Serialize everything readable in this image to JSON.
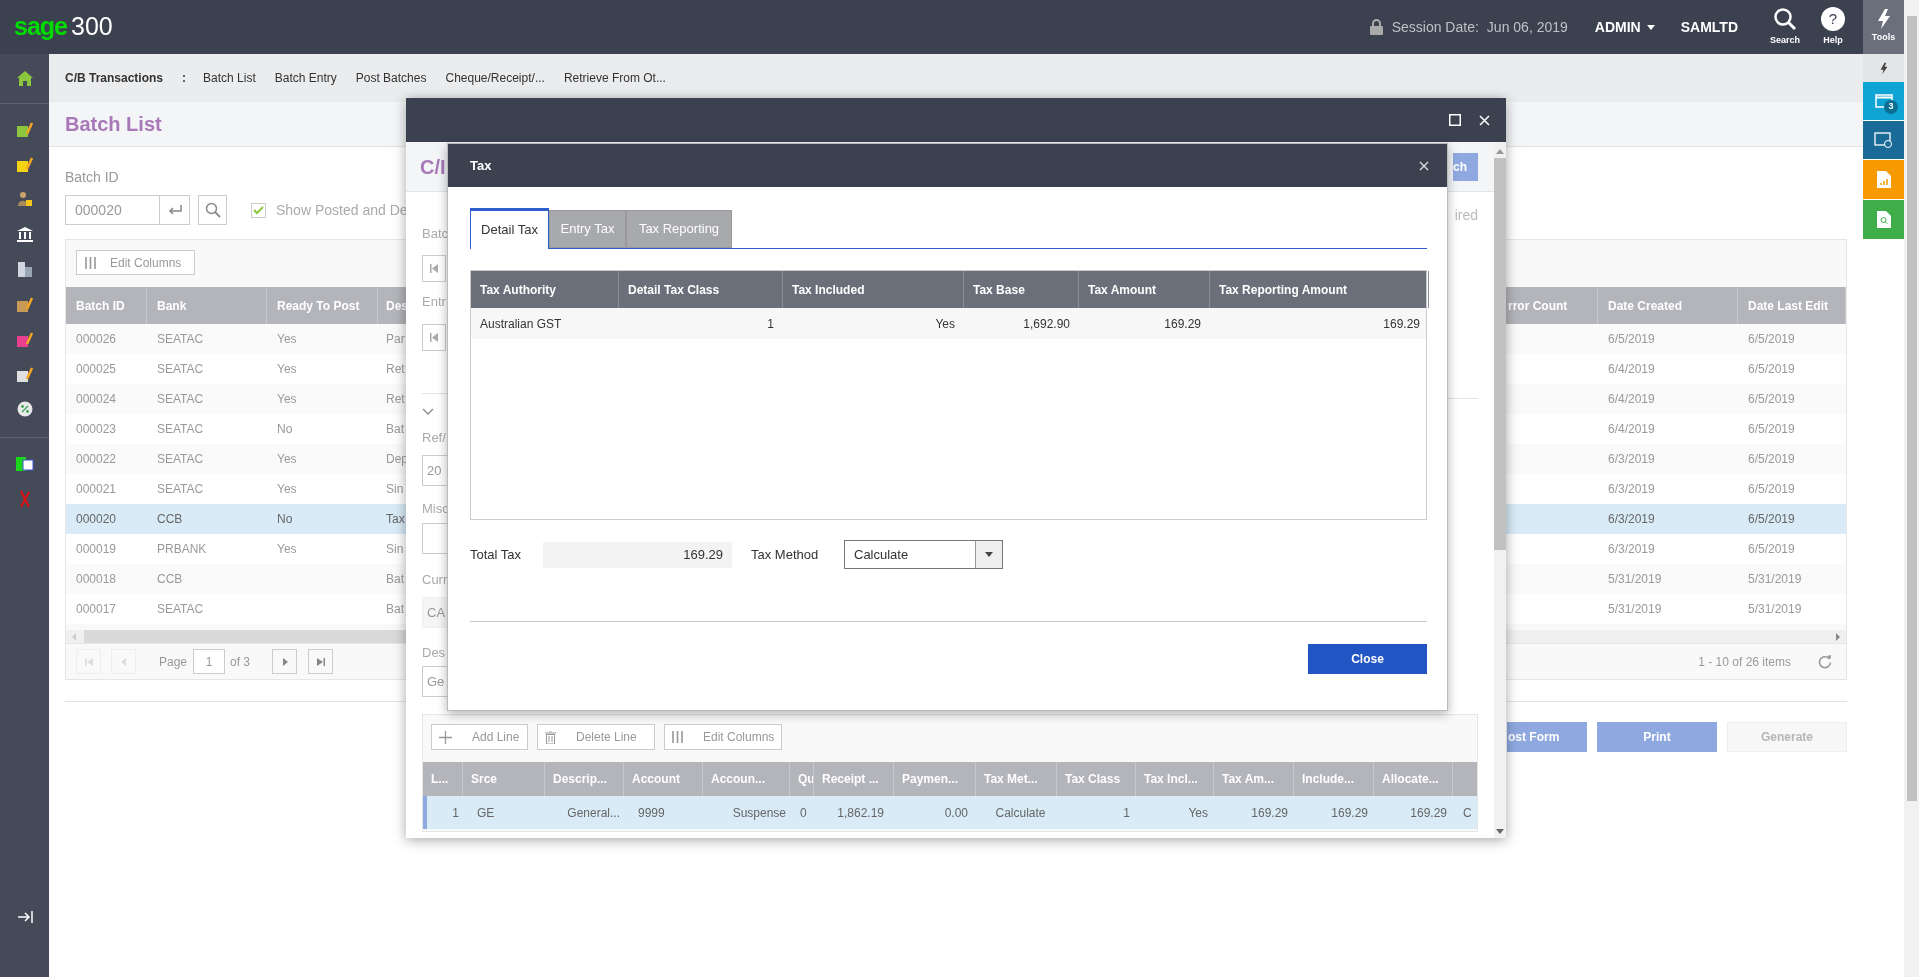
{
  "top_bar": {
    "logo_brand": "sage",
    "logo_product": "300",
    "session_label": "Session Date:",
    "session_date": "Jun 06, 2019",
    "user": "ADMIN",
    "company": "SAMLTD",
    "search_label": "Search",
    "help_label": "Help",
    "help_glyph": "?"
  },
  "tool_rail": {
    "tools_label": "Tools",
    "window_count": "3"
  },
  "breadcrumb": {
    "title": "C/B Transactions",
    "separator": ":",
    "links": [
      "Batch List",
      "Batch Entry",
      "Post Batches",
      "Cheque/Receipt/...",
      "Retrieve From Ot..."
    ]
  },
  "page_title": "Batch List",
  "filter": {
    "label": "Batch ID",
    "value": "000020",
    "show_posted_label": "Show Posted and De",
    "show_posted_checked": true
  },
  "edit_columns": "Edit Columns",
  "batch_table": {
    "columns_left": [
      "Batch ID",
      "Bank",
      "Ready To Post",
      "Des"
    ],
    "columns_right": [
      "rror Count",
      "Date Created",
      "Date Last Edit"
    ],
    "rows": [
      {
        "batch_id": "000026",
        "bank": "SEATAC",
        "ready": "Yes",
        "description": "Par",
        "date_created": "6/5/2019",
        "date_last_edit": "6/5/2019",
        "selected": false
      },
      {
        "batch_id": "000025",
        "bank": "SEATAC",
        "ready": "Yes",
        "description": "Ret",
        "date_created": "6/4/2019",
        "date_last_edit": "6/5/2019",
        "selected": false
      },
      {
        "batch_id": "000024",
        "bank": "SEATAC",
        "ready": "Yes",
        "description": "Ret",
        "date_created": "6/4/2019",
        "date_last_edit": "6/5/2019",
        "selected": false
      },
      {
        "batch_id": "000023",
        "bank": "SEATAC",
        "ready": "No",
        "description": "Bat",
        "date_created": "6/4/2019",
        "date_last_edit": "6/5/2019",
        "selected": false
      },
      {
        "batch_id": "000022",
        "bank": "SEATAC",
        "ready": "Yes",
        "description": "Dep",
        "date_created": "6/3/2019",
        "date_last_edit": "6/5/2019",
        "selected": false
      },
      {
        "batch_id": "000021",
        "bank": "SEATAC",
        "ready": "Yes",
        "description": "Sin",
        "date_created": "6/3/2019",
        "date_last_edit": "6/5/2019",
        "selected": false
      },
      {
        "batch_id": "000020",
        "bank": "CCB",
        "ready": "No",
        "description": "Tax",
        "date_created": "6/3/2019",
        "date_last_edit": "6/5/2019",
        "selected": true
      },
      {
        "batch_id": "000019",
        "bank": "PRBANK",
        "ready": "Yes",
        "description": "Sin",
        "date_created": "6/3/2019",
        "date_last_edit": "6/5/2019",
        "selected": false
      },
      {
        "batch_id": "000018",
        "bank": "CCB",
        "description": "Bat",
        "date_created": "5/31/2019",
        "date_last_edit": "5/31/2019",
        "selected": false
      },
      {
        "batch_id": "000017",
        "bank": "SEATAC",
        "description": "Bat",
        "date_created": "5/31/2019",
        "date_last_edit": "5/31/2019",
        "selected": false
      }
    ]
  },
  "pager": {
    "label": "Page",
    "page": "1",
    "of": "of 3",
    "summary": "1 - 10 of 26 items"
  },
  "actions": [
    {
      "label": "ost Form",
      "disabled": false
    },
    {
      "label": "Print",
      "disabled": false
    },
    {
      "label": "Generate",
      "disabled": true
    }
  ],
  "entry_window": {
    "title": "C/I",
    "side_button": "ch",
    "required_note": "ired",
    "batch_label": "Batc",
    "entry_label": "Entr",
    "ref_label": "Ref/",
    "ref_value": "20",
    "misc_label": "Misc",
    "currency_label": "Curr",
    "currency_value": "CA",
    "desc_label": "Des",
    "desc_value": "Ge",
    "toolbar": [
      {
        "kind": "add",
        "label": "Add Line"
      },
      {
        "kind": "delete",
        "label": "Delete Line"
      },
      {
        "kind": "columns",
        "label": "Edit Columns"
      }
    ],
    "grid": {
      "columns": [
        "L...",
        "Srce",
        "Descrip...",
        "Account",
        "Accoun...",
        "Qu",
        "Receipt ...",
        "Paymen...",
        "Tax Met...",
        "Tax Class",
        "Tax Incl...",
        "Tax Am...",
        "Include...",
        "Allocate..."
      ],
      "rows": [
        {
          "cells": [
            "1",
            "GE",
            "General...",
            "9999",
            "Suspense",
            "0",
            "1,862.19",
            "0.00",
            "Calculate",
            "1",
            "Yes",
            "169.29",
            "169.29",
            "169.29",
            "C"
          ],
          "selected": true
        }
      ]
    }
  },
  "tax_dialog": {
    "title": "Tax",
    "tabs": [
      {
        "label": "Detail Tax",
        "selected": true
      },
      {
        "label": "Entry Tax",
        "selected": false
      },
      {
        "label": "Tax Reporting",
        "selected": false
      }
    ],
    "columns": [
      "Tax Authority",
      "Detail Tax Class",
      "Tax Included",
      "Tax Base",
      "Tax Amount",
      "Tax Reporting Amount"
    ],
    "rows": [
      [
        "Australian GST",
        "1",
        "Yes",
        "1,692.90",
        "169.29",
        "169.29"
      ]
    ],
    "total_tax_label": "Total Tax",
    "total_tax": "169.29",
    "tax_method_label": "Tax Method",
    "tax_method": "Calculate",
    "close_button": "Close"
  }
}
